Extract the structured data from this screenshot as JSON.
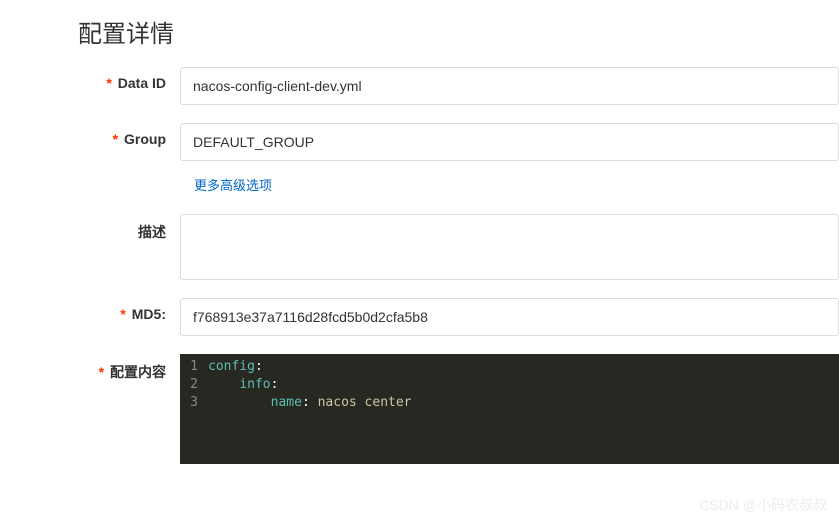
{
  "title": "配置详情",
  "fields": {
    "dataId": {
      "label": "Data ID",
      "value": "nacos-config-client-dev.yml"
    },
    "group": {
      "label": "Group",
      "value": "DEFAULT_GROUP"
    },
    "desc": {
      "label": "描述",
      "value": ""
    },
    "md5": {
      "label": "MD5:",
      "value": "f768913e37a7116d28fcd5b0d2cfa5b8"
    },
    "content": {
      "label": "配置内容"
    }
  },
  "advancedLink": "更多高级选项",
  "code": {
    "lines": [
      {
        "num": "1",
        "indent": 0,
        "key": "config",
        "val": ""
      },
      {
        "num": "2",
        "indent": 1,
        "key": "info",
        "val": ""
      },
      {
        "num": "3",
        "indent": 2,
        "key": "name",
        "val": "nacos center"
      }
    ]
  },
  "watermark": "CSDN @小码农叔叔"
}
